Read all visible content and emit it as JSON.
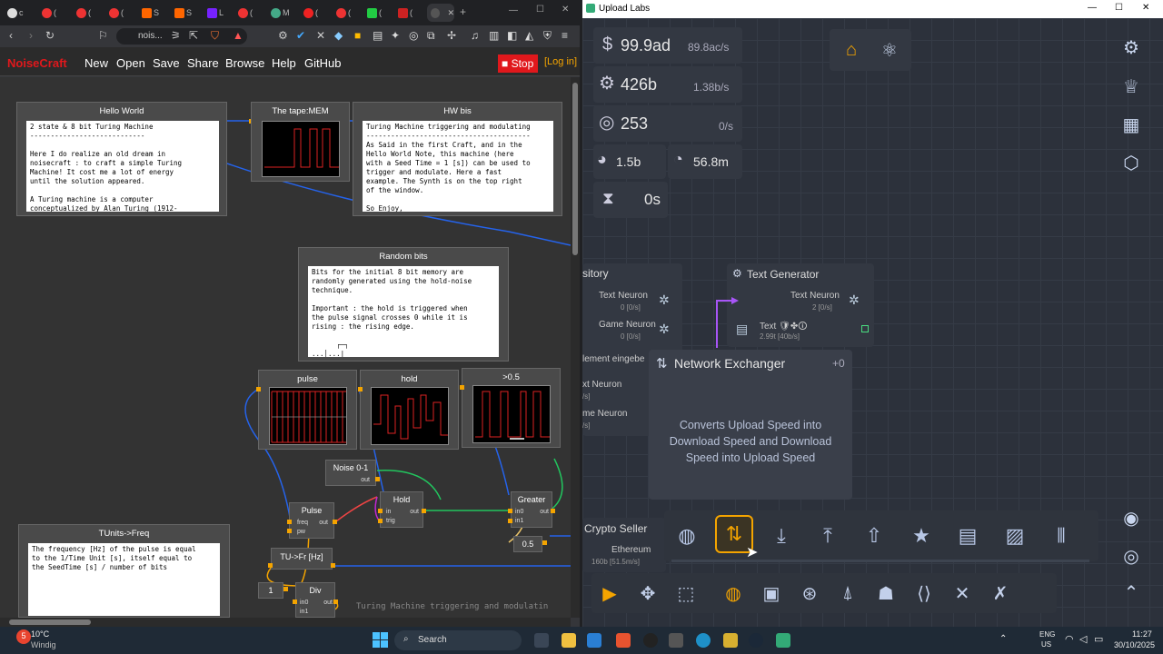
{
  "left_browser": {
    "tabs": [
      "c",
      "(",
      "(",
      "(",
      "S",
      "S",
      "L",
      "(",
      "M",
      "(",
      "(",
      "(",
      "(",
      ""
    ],
    "url": "nois...",
    "menu": {
      "brand": "NoiseCraft",
      "items": [
        "New",
        "Open",
        "Save",
        "Share",
        "Browse",
        "Help",
        "GitHub"
      ],
      "stop": "Stop",
      "login": "[Log in]"
    },
    "nodes": {
      "hello": {
        "title": "Hello World",
        "text": "2 state & 8 bit Turing Machine\n----------------------------\n\nHere I do realize an old dream in\nnoisecraft : to craft a simple Turing\nMachine! It cost me a lot of energy\nuntil the solution appeared.\n\nA Turing machine is a computer\nconceptualized by Alan Turing (1912-"
      },
      "tape": {
        "title": "The tape:MEM"
      },
      "hwbis": {
        "title": "HW bis",
        "text": "Turing Machine triggering and modulating\n----------------------------------------\nAs Said in the first Craft, and in the\nHello World Note, this machine (here\nwith a Seed Time = 1 [s]) can be used to\ntrigger and modulate. Here a fast\nexample. The Synth is on the top right\nof the window.\n\nSo Enjoy,"
      },
      "random": {
        "title": "Random bits",
        "text": "Bits for the initial 8 bit memory are\nrandomly generated using the hold-noise\ntechnique.\n\nImportant : the hold is triggered when\nthe pulse signal crosses 0 while it is\nrising : the rising edge.\n\n      ┌─┐\n...│...|"
      },
      "pulse": {
        "title": "pulse"
      },
      "hold": {
        "title": "hold"
      },
      "gt": {
        "title": ">0.5"
      },
      "noise": {
        "title": "Noise 0-1",
        "out": "out"
      },
      "pulsenode": {
        "title": "Pulse",
        "p1": "freq",
        "p2": "pw",
        "out": "out"
      },
      "holdnode": {
        "title": "Hold",
        "p1": "in",
        "p2": "trig",
        "out": "out"
      },
      "greater": {
        "title": "Greater",
        "p1": "in0",
        "p2": "in1",
        "out": "out"
      },
      "const05": {
        "title": "0.5"
      },
      "tunits": {
        "title": "TUnits->Freq",
        "text": "The frequency [Hz] of the pulse is equal\nto the 1/Time Unit [s], itself equal to\nthe SeedTime [s] / number of bits"
      },
      "tufr": {
        "title": "TU->Fr [Hz]"
      },
      "one": {
        "title": "1"
      },
      "div": {
        "title": "Div",
        "p1": "in0",
        "p2": "in1",
        "out": "out"
      },
      "footer": "Turing Machine triggering and modulatin"
    }
  },
  "right_app": {
    "title": "Upload Labs",
    "stats": {
      "money": "99.9ad",
      "money_rate": "89.8ac/s",
      "research": "426b",
      "research_rate": "1.38b/s",
      "tokens": "253",
      "tokens_rate": "0/s",
      "pie": "1.5b",
      "clock": "56.8m",
      "timer": "0s"
    },
    "repository": {
      "title": "sitory",
      "r1": "Text Neuron",
      "r1v": "0 [0/s]",
      "r2": "Game Neuron",
      "r2v": "0 [0/s]",
      "r3": "lement eingebe",
      "r4": "xt Neuron",
      "r4v": "/s]",
      "r5": "me Neuron",
      "r5v": "/s]"
    },
    "textgen": {
      "title": "Text Generator",
      "label": "Text Neuron",
      "label_v": "2 [0/s]",
      "out": "Text 🛡✤🛈",
      "out_v": "2.99t [40b/s]"
    },
    "exchanger": {
      "title": "Network Exchanger",
      "count": "+0",
      "desc": "Converts Upload Speed into\nDownload Speed and Download\nSpeed into Upload Speed"
    },
    "crypto": {
      "title": "Crypto Seller",
      "item": "Ethereum",
      "item_v": "160b [51.5m/s]"
    }
  },
  "taskbar": {
    "weather_temp": "10°C",
    "weather_desc": "Windig",
    "search": "Search",
    "lang1": "ENG",
    "lang2": "US",
    "time": "11:27",
    "date": "30/10/2025",
    "badge": "5"
  },
  "colors": {
    "accent": "#f4a400",
    "stop": "#e0181c",
    "brand": "#e0181c"
  }
}
